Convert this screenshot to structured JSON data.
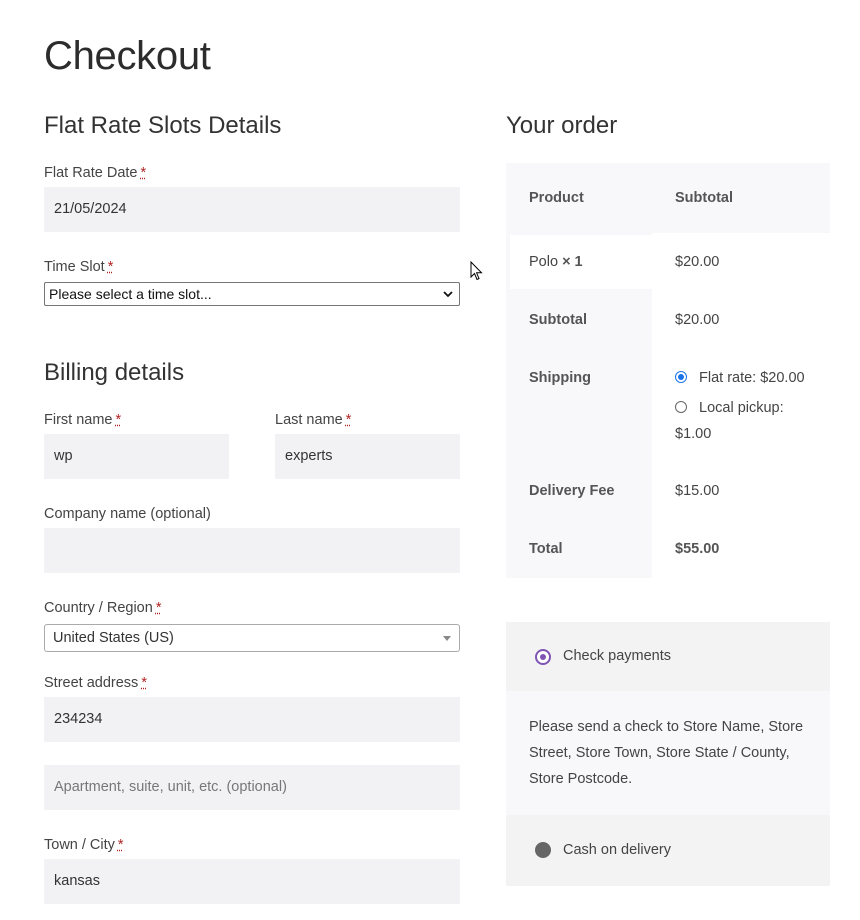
{
  "page": {
    "title": "Checkout"
  },
  "slots": {
    "heading": "Flat Rate Slots Details",
    "date_label": "Flat Rate Date",
    "date_value": "21/05/2024",
    "time_label": "Time Slot",
    "time_value": "Please select a time slot..."
  },
  "billing": {
    "heading": "Billing details",
    "first_name_label": "First name",
    "first_name_value": "wp",
    "last_name_label": "Last name",
    "last_name_value": "experts",
    "company_label": "Company name (optional)",
    "company_value": "",
    "country_label": "Country / Region",
    "country_value": "United States (US)",
    "street_label": "Street address",
    "street_value": "234234",
    "apartment_placeholder": "Apartment, suite, unit, etc. (optional)",
    "city_label": "Town / City",
    "city_value": "kansas",
    "required_mark": "*"
  },
  "order": {
    "heading": "Your order",
    "col_product": "Product",
    "col_subtotal": "Subtotal",
    "item_name": "Polo",
    "item_qty": "× 1",
    "item_price": "$20.00",
    "subtotal_label": "Subtotal",
    "subtotal_value": "$20.00",
    "shipping_label": "Shipping",
    "shipping_options": [
      {
        "label": "Flat rate: $20.00",
        "selected": true
      },
      {
        "label_line1": "Local pickup:",
        "label_line2": "$1.00",
        "selected": false
      }
    ],
    "fee_label": "Delivery Fee",
    "fee_value": "$15.00",
    "total_label": "Total",
    "total_value": "$55.00"
  },
  "payment": {
    "methods": [
      {
        "label": "Check payments",
        "selected": true
      },
      {
        "label": "Cash on delivery",
        "selected": false
      }
    ],
    "check_description": [
      "Please send a check to Store Name, Store",
      "Street, Store Town, Store State / County,",
      "Store Postcode."
    ]
  },
  "colors": {
    "accent": "#7f54b3",
    "radio_blue": "#1a73e8",
    "field_bg": "#f2f2f4"
  },
  "icons": {
    "cursor": "mouse-pointer-icon",
    "select_chevron": "chevron-down-icon",
    "select_caret": "caret-down-icon"
  }
}
